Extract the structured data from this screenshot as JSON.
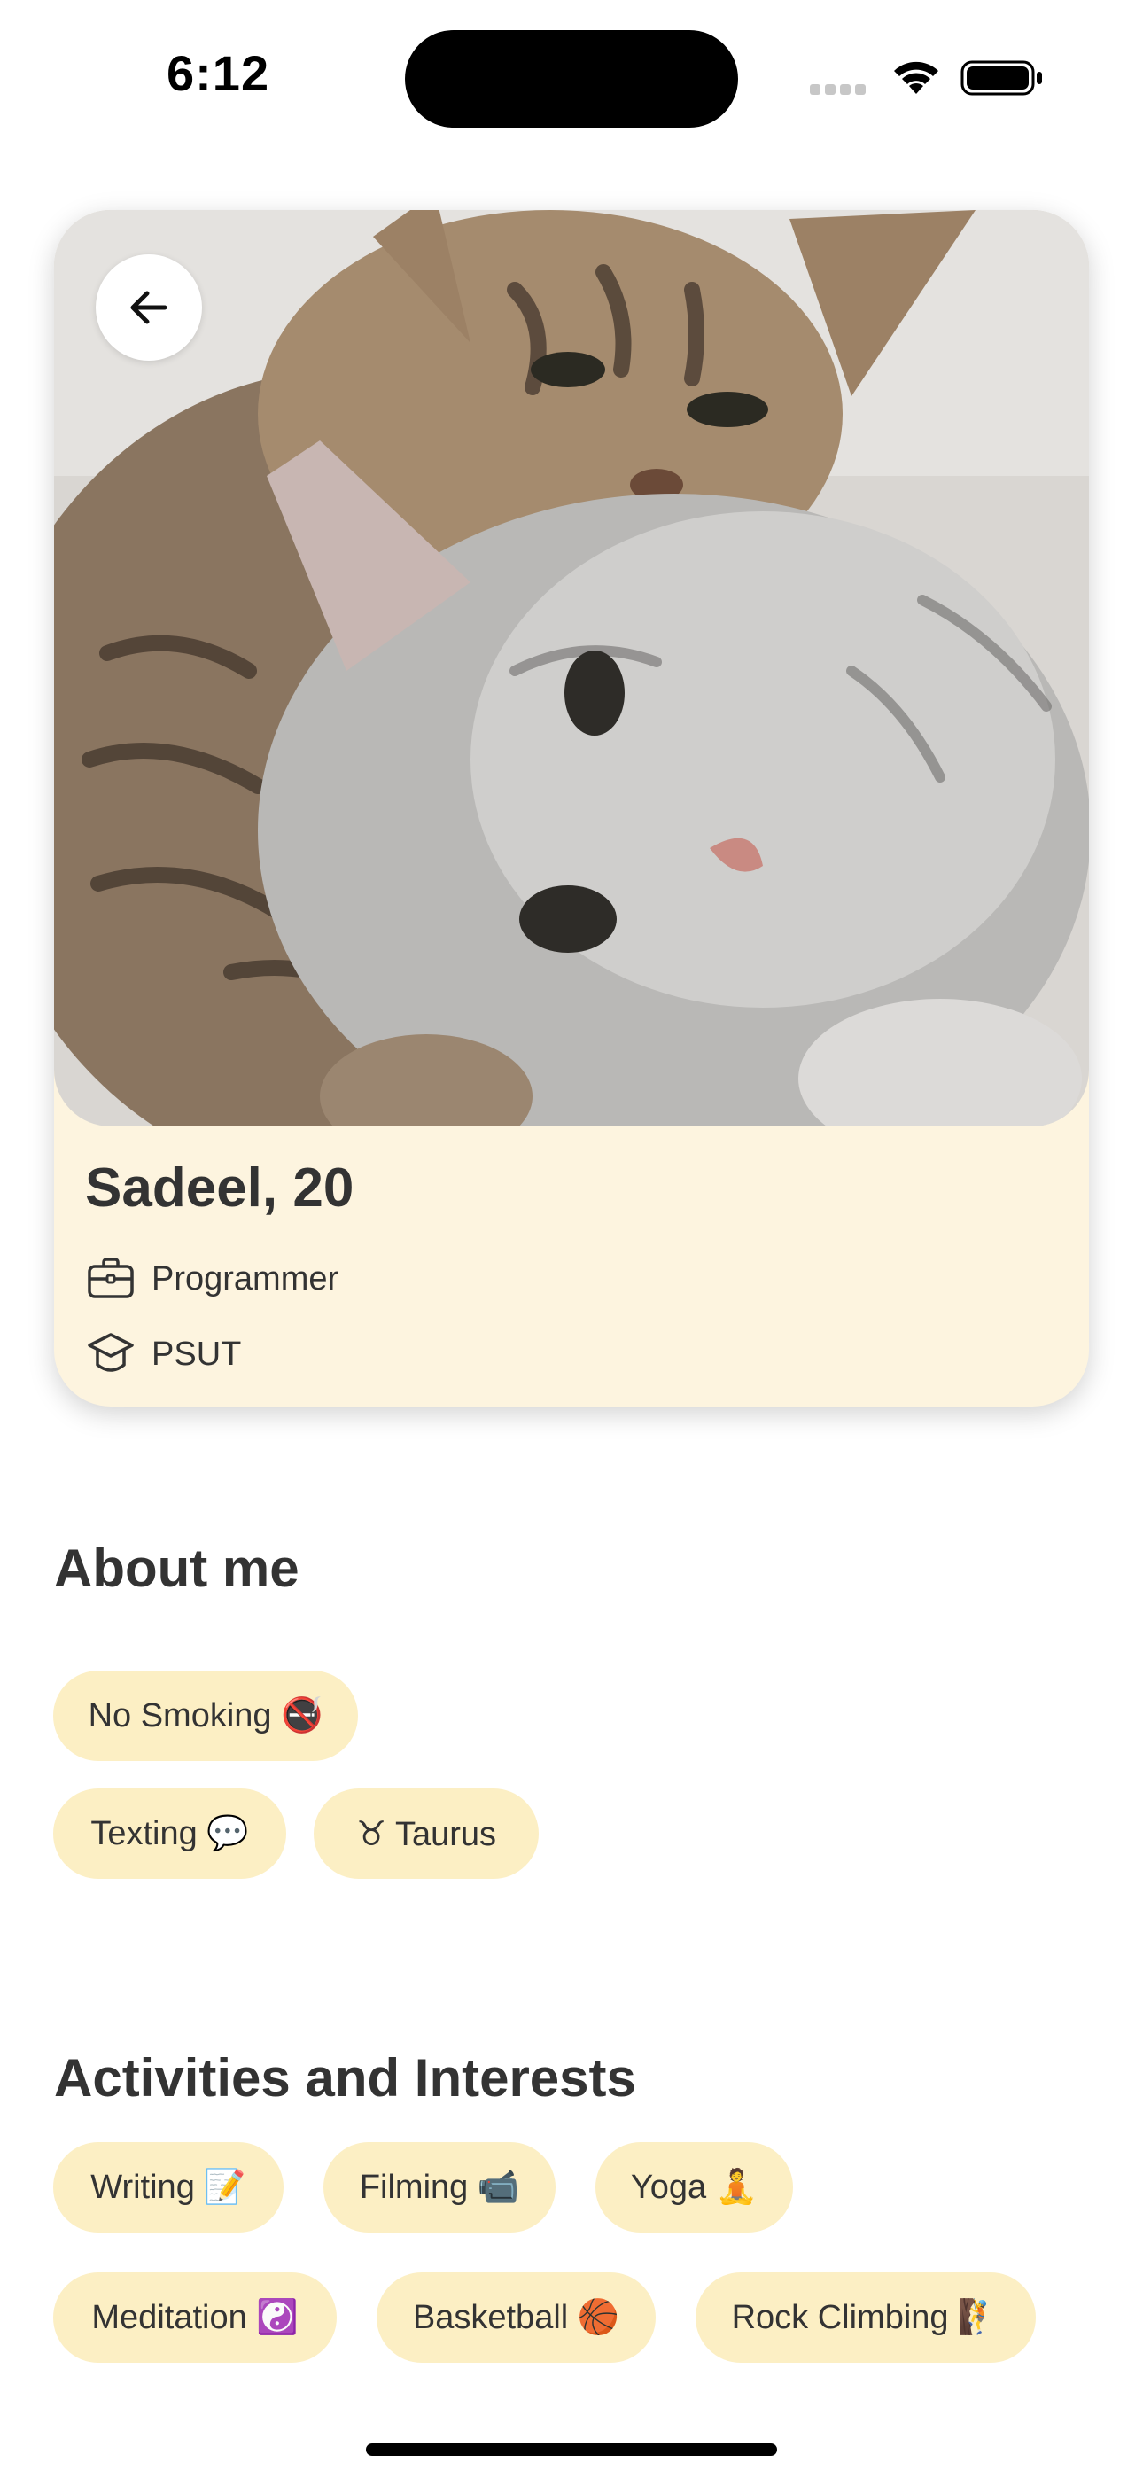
{
  "status_bar": {
    "time": "6:12"
  },
  "profile": {
    "name_age": "Sadeel, 20",
    "job": "Programmer",
    "school": "PSUT"
  },
  "about": {
    "title": "About me",
    "chips": [
      "No Smoking 🚭",
      "Texting 💬",
      "♉ Taurus"
    ]
  },
  "interests": {
    "title": "Activities and Interests",
    "chips": [
      "Writing 📝",
      "Filming 📹",
      "Yoga 🧘",
      "Meditation ☯️",
      "Basketball 🏀",
      "Rock Climbing 🧗"
    ]
  },
  "colors": {
    "card_bg": "#fdf4df",
    "chip_bg": "#fcefc4",
    "text": "#333333"
  }
}
